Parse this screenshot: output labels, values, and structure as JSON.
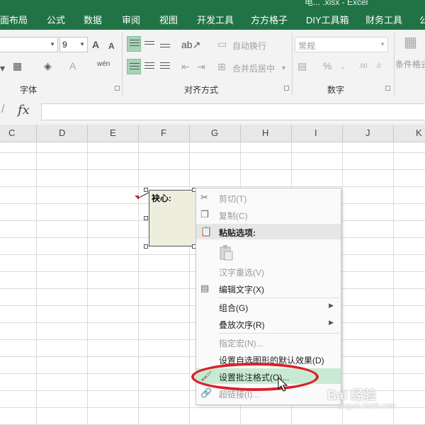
{
  "app": {
    "title": "电... .xlsx - Excel"
  },
  "ribbon_tabs": [
    "面布局",
    "公式",
    "数据",
    "审阅",
    "视图",
    "开发工具",
    "方方格子",
    "DIY工具箱",
    "财务工具",
    "公"
  ],
  "ribbon": {
    "font_size": "9",
    "grow_font": "A",
    "shrink_font": "A",
    "wrap_text": "自动换行",
    "merge_center": "合并后居中",
    "number_format": "常规",
    "percent": "%",
    "comma": ",",
    "conditional_format": "条件格式",
    "groups": {
      "font": "字体",
      "alignment": "对齐方式",
      "number": "数字"
    }
  },
  "formula_bar": {
    "fx": "fx",
    "value": ""
  },
  "columns": [
    "C",
    "D",
    "E",
    "F",
    "G",
    "H",
    "I",
    "J",
    "K"
  ],
  "comment": {
    "text": "袂心:"
  },
  "context_menu": {
    "items": [
      {
        "label": "剪切(T)",
        "disabled": true,
        "icon": "scissors-icon"
      },
      {
        "label": "复制(C)",
        "disabled": true,
        "icon": "copy-icon"
      },
      {
        "label": "粘贴选项:",
        "header": true,
        "icon": "paste-icon"
      },
      {
        "label": "汉字重选(V)",
        "disabled": true
      },
      {
        "label": "编辑文字(X)",
        "disabled": false,
        "icon": "edit-text-icon"
      },
      {
        "label": "组合(G)",
        "disabled": false,
        "submenu": true
      },
      {
        "label": "叠放次序(R)",
        "disabled": false,
        "submenu": true
      },
      {
        "label": "指定宏(N)...",
        "disabled": true
      },
      {
        "label": "设置自选图形的默认效果(D)",
        "disabled": false
      },
      {
        "label": "设置批注格式(O)...",
        "disabled": false,
        "highlighted": true,
        "icon": "format-comment-icon"
      },
      {
        "label": "超链接(I)...",
        "disabled": true,
        "icon": "link-icon"
      }
    ]
  },
  "watermark": {
    "text": "Bai 经验",
    "sub": "jingyan.baidu.com"
  },
  "colors": {
    "ribbon_green": "#217346",
    "highlight": "#c9ead2",
    "annotation_red": "#d9222a"
  }
}
